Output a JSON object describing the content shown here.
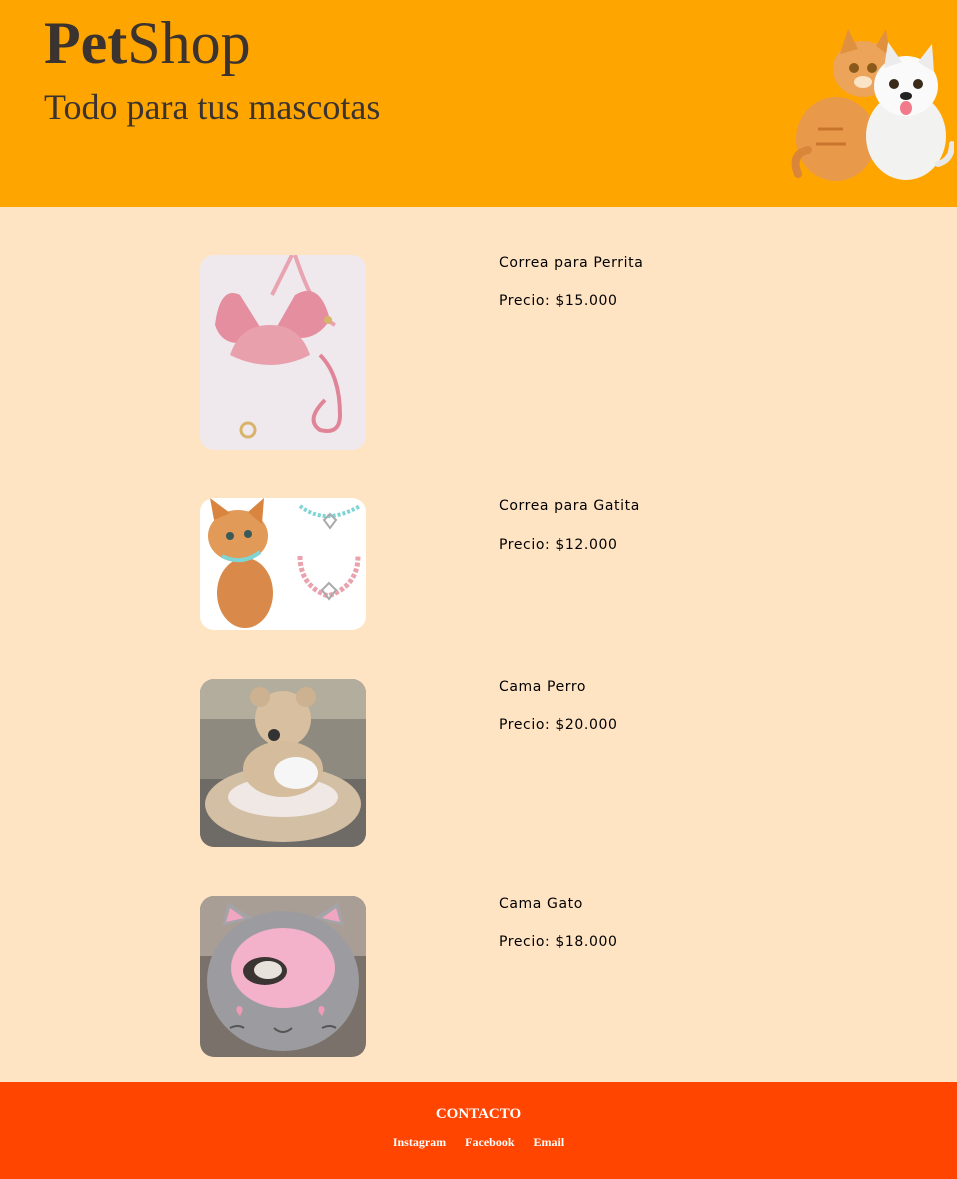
{
  "header": {
    "brand_bold": "Pet",
    "brand_rest": "Shop",
    "tagline": "Todo para tus mascotas"
  },
  "products": [
    {
      "name": "Correa para Perrita",
      "price": "Precio: $15.000"
    },
    {
      "name": "Correa para Gatita",
      "price": "Precio: $12.000"
    },
    {
      "name": "Cama Perro",
      "price": "Precio: $20.000"
    },
    {
      "name": "Cama Gato",
      "price": "Precio: $18.000"
    }
  ],
  "footer": {
    "title": "CONTACTO",
    "links": [
      "Instagram",
      "Facebook",
      "Email"
    ]
  },
  "colors": {
    "header_bg": "#ffa500",
    "page_bg": "#ffe4c4",
    "footer_bg": "#ff4500"
  }
}
